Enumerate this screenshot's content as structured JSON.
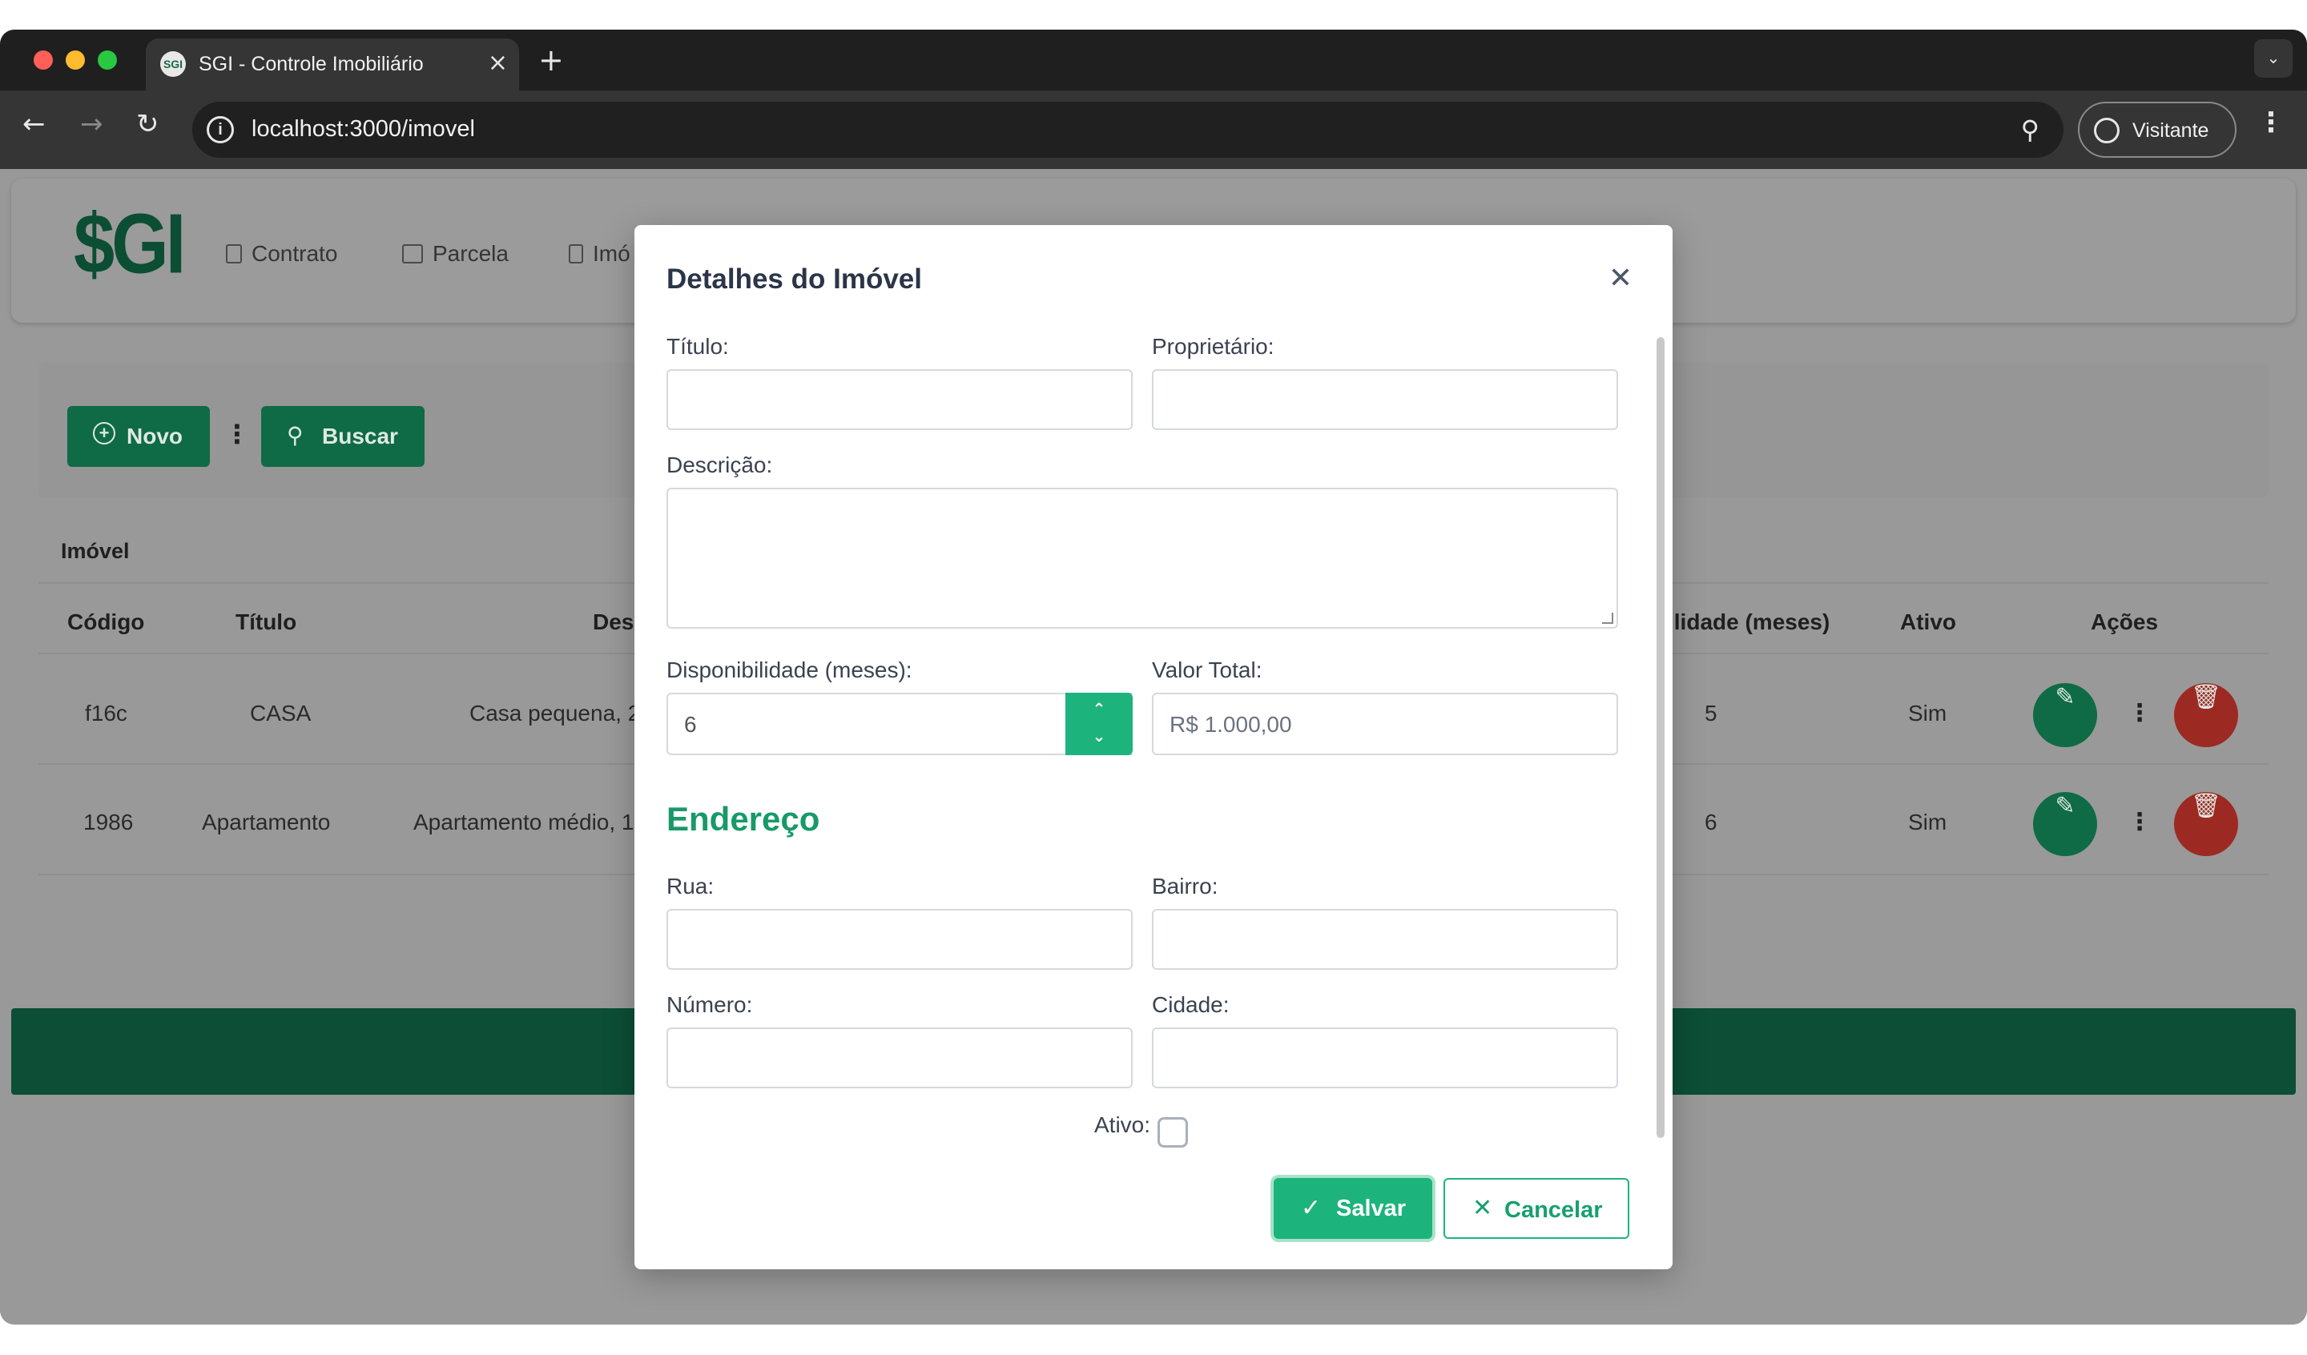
{
  "browser": {
    "tab_title": "SGI - Controle Imobiliário",
    "tab_favicon_text": "SGI",
    "url": "localhost:3000/imovel",
    "profile_label": "Visitante"
  },
  "app": {
    "logo": "$GI",
    "nav": [
      {
        "label": "Contrato",
        "icon": "file-icon"
      },
      {
        "label": "Parcela",
        "icon": "wallet-icon"
      },
      {
        "label": "Imó",
        "icon": "building-icon"
      }
    ],
    "toolbar": {
      "new_label": "Novo",
      "search_label": "Buscar"
    },
    "table": {
      "title": "Imóvel",
      "headers": {
        "codigo": "Código",
        "titulo": "Título",
        "descricao": "Desc",
        "disponibilidade": "ilidade (meses)",
        "ativo": "Ativo",
        "acoes": "Ações"
      },
      "rows": [
        {
          "codigo": "f16c",
          "titulo": "CASA",
          "descricao": "Casa pequena, 2",
          "disponibilidade": "5",
          "ativo": "Sim"
        },
        {
          "codigo": "1986",
          "titulo": "Apartamento",
          "descricao": "Apartamento médio, 1",
          "disponibilidade": "6",
          "ativo": "Sim"
        }
      ]
    }
  },
  "modal": {
    "title": "Detalhes do Imóvel",
    "fields": {
      "titulo_label": "Título:",
      "proprietario_label": "Proprietário:",
      "descricao_label": "Descrição:",
      "disponibilidade_label": "Disponibilidade (meses):",
      "disponibilidade_value": "6",
      "valor_total_label": "Valor Total:",
      "valor_total_placeholder": "R$ 1.000,00",
      "rua_label": "Rua:",
      "bairro_label": "Bairro:",
      "numero_label": "Número:",
      "cidade_label": "Cidade:",
      "ativo_label": "Ativo:"
    },
    "section_endereco": "Endereço",
    "save_label": "Salvar",
    "cancel_label": "Cancelar"
  },
  "colors": {
    "brand_dark": "#0f6b45",
    "accent": "#1db37c",
    "danger": "#c0392b"
  }
}
